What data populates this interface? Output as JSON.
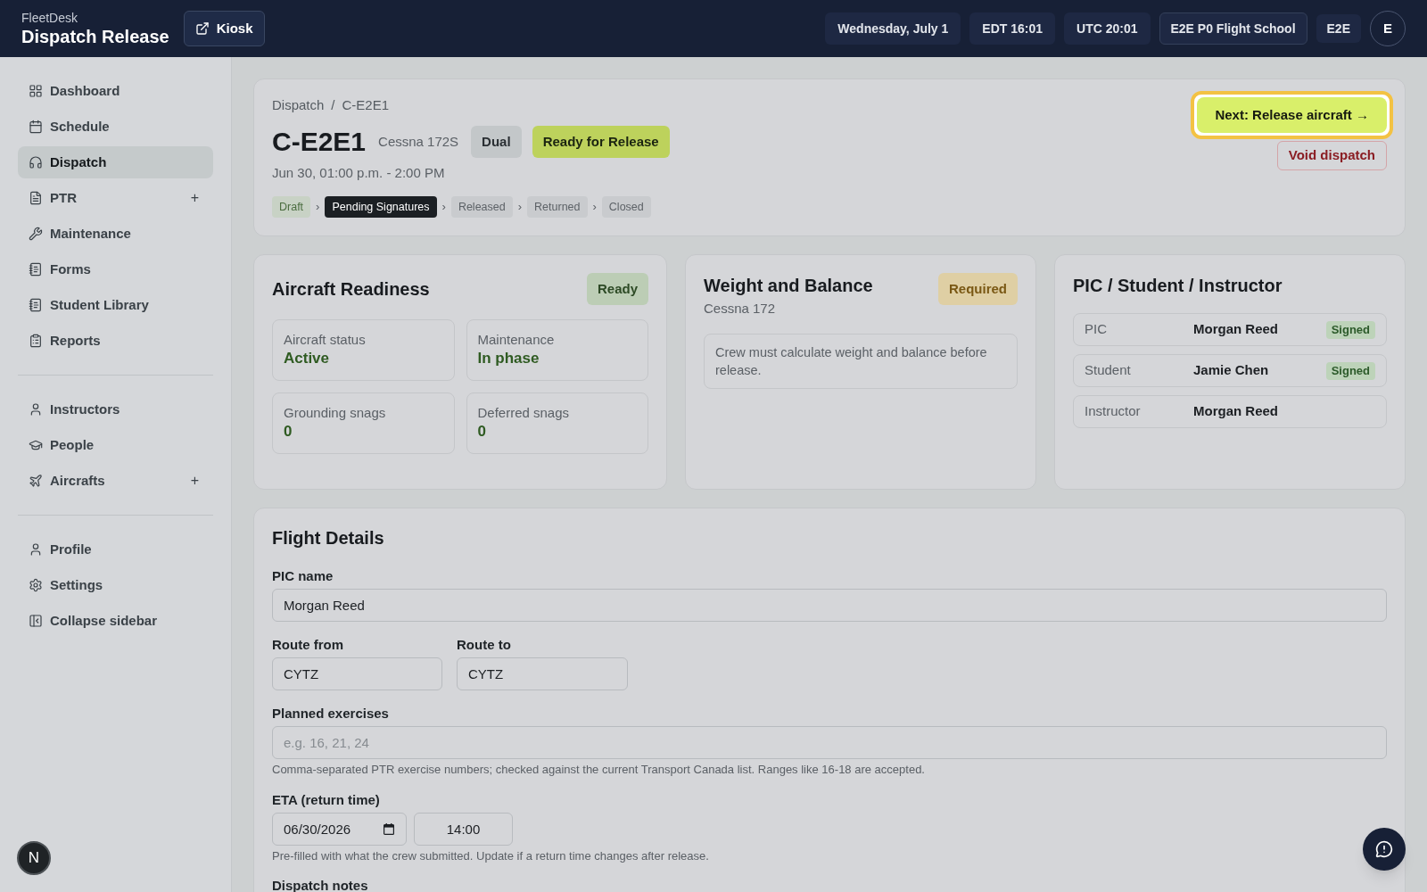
{
  "header": {
    "app_name": "FleetDesk",
    "title": "Dispatch Release",
    "kiosk_button": "Kiosk",
    "chips": [
      "Wednesday, July 1",
      "EDT 16:01",
      "UTC 20:01"
    ],
    "organization": "E2E P0 Flight School",
    "user_code": "E2E",
    "avatar_initial": "E"
  },
  "sidebar": {
    "sections": [
      {
        "items": [
          {
            "label": "Dashboard",
            "selected": false
          },
          {
            "label": "Schedule",
            "selected": false
          },
          {
            "label": "Dispatch",
            "selected": true
          },
          {
            "label": "PTR",
            "selected": false,
            "action": "+"
          },
          {
            "label": "Maintenance",
            "selected": false
          },
          {
            "label": "Forms",
            "selected": false
          },
          {
            "label": "Student Library",
            "selected": false
          },
          {
            "label": "Reports",
            "selected": false
          }
        ]
      },
      {
        "items": [
          {
            "label": "Instructors",
            "selected": false
          },
          {
            "label": "People",
            "selected": false
          },
          {
            "label": "Aircrafts",
            "selected": false,
            "action": "+"
          }
        ]
      },
      {
        "items": [
          {
            "label": "Profile",
            "selected": false
          },
          {
            "label": "Settings",
            "selected": false
          },
          {
            "label": "Collapse sidebar",
            "selected": false
          }
        ]
      }
    ]
  },
  "dispatch": {
    "breadcrumb": [
      {
        "label": "Dispatch"
      },
      {
        "separator": "/",
        "label": "C-E2E1"
      }
    ],
    "registration": "C-E2E1",
    "model": "Cessna 172S",
    "badges": [
      {
        "label": "Dual",
        "kind": "neutral"
      },
      {
        "label": "Ready for Release",
        "kind": "primary"
      }
    ],
    "schedule": "Jun 30, 01:00 p.m. - 2:00 PM",
    "steps": [
      {
        "label": "Draft",
        "completed": true,
        "current": false
      },
      {
        "separator": "›",
        "label": "Pending Signatures",
        "completed": false,
        "current": true
      },
      {
        "separator": "›",
        "label": "Released",
        "completed": false,
        "current": false
      },
      {
        "separator": "›",
        "label": "Returned",
        "completed": false,
        "current": false
      },
      {
        "separator": "›",
        "label": "Closed",
        "completed": false,
        "current": false
      }
    ],
    "primary_action": {
      "label": "Next: Release aircraft →",
      "highlighted": true
    },
    "void_button": "Void dispatch"
  },
  "readiness": {
    "title": "Aircraft Readiness",
    "badge": {
      "label": "Ready",
      "kind": "success"
    },
    "stats": [
      {
        "label": "Aircraft status",
        "value": "Active"
      },
      {
        "label": "Maintenance",
        "value": "In phase"
      },
      {
        "label": "Grounding snags",
        "value": "0"
      },
      {
        "label": "Deferred snags",
        "value": "0"
      }
    ]
  },
  "weight_balance": {
    "title": "Weight and Balance",
    "subtitle": "Cessna 172",
    "badge": {
      "label": "Required",
      "kind": "warning"
    },
    "note": "Crew must calculate weight and balance before release."
  },
  "crew": {
    "title": "PIC / Student / Instructor",
    "rows": [
      {
        "role": "PIC",
        "name": "Morgan Reed",
        "badge": "Signed"
      },
      {
        "role": "Student",
        "name": "Jamie Chen",
        "badge": "Signed"
      },
      {
        "role": "Instructor",
        "name": "Morgan Reed"
      }
    ]
  },
  "flight_details": {
    "title": "Flight Details",
    "pic_name": {
      "label": "PIC name",
      "value": "Morgan Reed"
    },
    "route_from": {
      "label": "Route from",
      "value": "CYTZ"
    },
    "route_to": {
      "label": "Route to",
      "value": "CYTZ"
    },
    "planned_exercises": {
      "label": "Planned exercises",
      "placeholder": "e.g. 16, 21, 24",
      "help": "Comma-separated PTR exercise numbers; checked against the current Transport Canada list. Ranges like 16-18 are accepted."
    },
    "eta": {
      "label": "ETA (return time)",
      "date": "06/30/2026",
      "time": "14:00",
      "help": "Pre-filled with what the crew submitted. Update if a return time changes after release."
    },
    "dispatch_notes": {
      "label": "Dispatch notes"
    }
  },
  "dev_indicator": "N"
}
